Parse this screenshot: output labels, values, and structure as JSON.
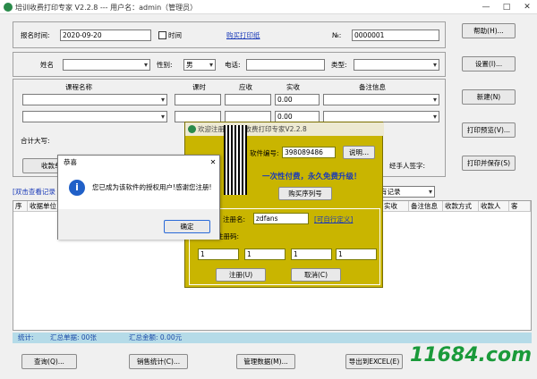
{
  "window": {
    "title": "培训收费打印专家 V2.2.8 --- 用户名：admin（管理员）"
  },
  "form": {
    "report_date_label": "报名时间:",
    "report_date": "2020-09-20",
    "time_label": "时间",
    "buy_paper_link": "购买打印纸",
    "no_label": "№:",
    "no_value": "0000001",
    "name_label": "姓名",
    "gender_label": "性别:",
    "gender_value": "男",
    "phone_label": "电话:",
    "type_label": "类型:",
    "course_label": "课程名称",
    "hours_label": "课时",
    "due_label": "应收",
    "paid_label": "实收",
    "remark_label": "备注信息",
    "paid_1": "0.00",
    "paid_2": "0.00",
    "total_cn_label": "合计大写:",
    "unit_label": "收款单位",
    "handler_label": "经手人签字:"
  },
  "side_buttons": {
    "help": "帮助(H)...",
    "settings": "设置(I)...",
    "new": "新建(N)",
    "preview": "打印预览(V)...",
    "print_save": "打印并保存(S)"
  },
  "list": {
    "hint": "[双击查看记录",
    "filter": "有记录",
    "columns": [
      "序",
      "收据单位",
      "实收",
      "备注信息",
      "收款方式",
      "收款人",
      "客"
    ]
  },
  "status": {
    "count_label": "统计:",
    "total_receipts": "汇总单据: 00张",
    "total_amount": "汇总金额: 0.00元"
  },
  "bottom_buttons": {
    "query": "查询(Q)...",
    "stats": "销售统计(C)...",
    "manage": "管理数据(M)...",
    "export": "导出到EXCEL(E)"
  },
  "register": {
    "title": "欢迎注册：培训收费打印专家V2.2.8",
    "serial_label": "软件编号:",
    "serial": "398089486",
    "explain_btn": "说明...",
    "slogan": "一次性付费，永久免费升级！",
    "buy_btn": "购买序列号",
    "user_label": "注册名:",
    "user_value": "zdfans",
    "custom_link": "[可自行定义]",
    "code_label": "您的注册码:",
    "code_1": "1",
    "code_2": "1",
    "code_3": "1",
    "code_4": "1",
    "reg_btn": "注册(U)",
    "cancel_btn": "取消(C)"
  },
  "message": {
    "title": "恭喜",
    "text": "您已成为该软件的授权用户!感谢您注册!",
    "ok": "确定"
  },
  "watermark": "11684.com",
  "colors": {
    "accent": "#1a3ab8",
    "dialog_bg": "#c9b500",
    "status_bg": "#b5dbe8"
  }
}
